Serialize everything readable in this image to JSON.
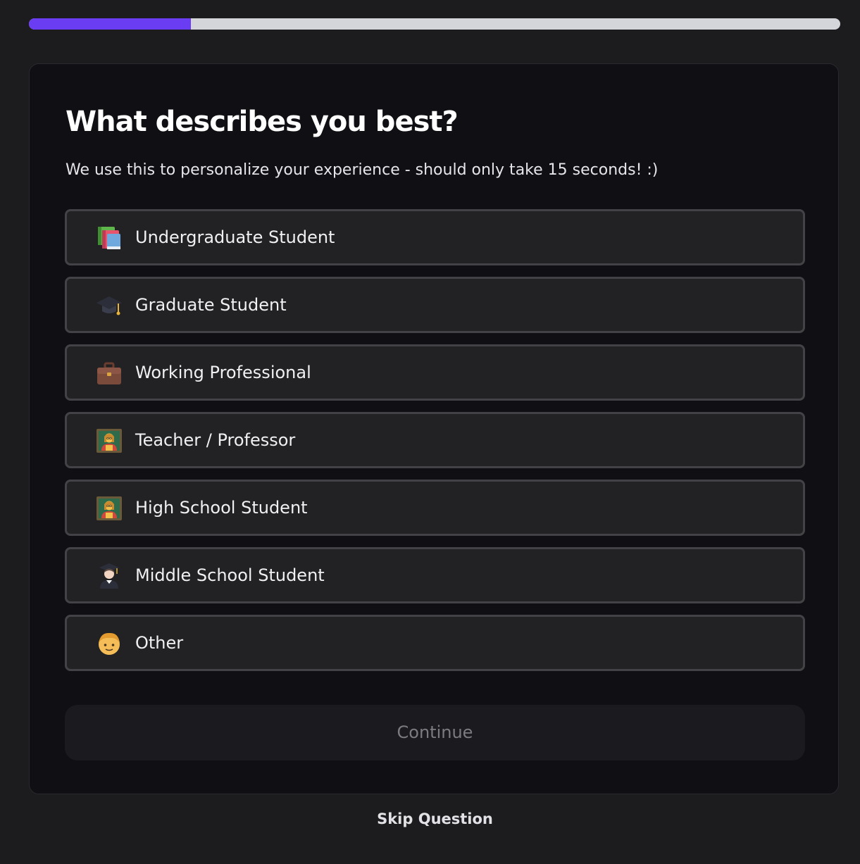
{
  "progress": {
    "fraction": 0.2
  },
  "question": {
    "title": "What describes you best?",
    "subtitle": "We use this to personalize your experience - should only take 15 seconds! :)"
  },
  "options": [
    {
      "label": "Undergraduate Student",
      "icon": "books-icon"
    },
    {
      "label": "Graduate Student",
      "icon": "graduation-cap-icon"
    },
    {
      "label": "Working Professional",
      "icon": "briefcase-icon"
    },
    {
      "label": "Teacher / Professor",
      "icon": "teacher-icon"
    },
    {
      "label": "High School Student",
      "icon": "teacher-icon"
    },
    {
      "label": "Middle School Student",
      "icon": "student-icon"
    },
    {
      "label": "Other",
      "icon": "person-face-icon"
    }
  ],
  "continue_label": "Continue",
  "skip_label": "Skip Question",
  "colors": {
    "accent": "#6a3cf2",
    "progress_track": "#d3d5da",
    "background": "#1c1c1e",
    "card": "#101014",
    "option_bg": "#222225",
    "option_border": "#434347"
  }
}
